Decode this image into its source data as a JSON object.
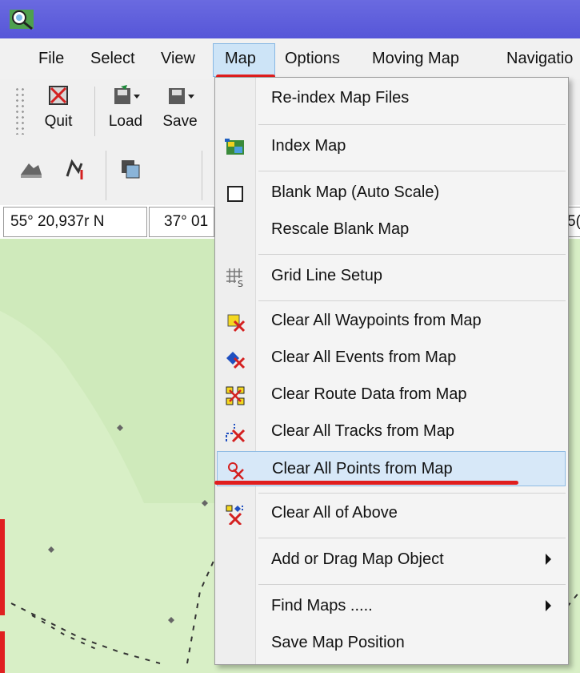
{
  "menubar": {
    "items": [
      "File",
      "Select",
      "View",
      "Map",
      "Options",
      "Moving Map",
      "Navigatio"
    ]
  },
  "toolbar": {
    "buttons": [
      {
        "label": "Quit",
        "icon": "quit-icon"
      },
      {
        "label": "Load",
        "icon": "load-icon"
      },
      {
        "label": "Save",
        "icon": "save-icon"
      }
    ]
  },
  "coords": {
    "lat": "55° 20,937r N",
    "lon": "37° 01",
    "right_fragment": "5("
  },
  "map_menu": {
    "items": [
      {
        "label": "Re-index Map Files",
        "icon": ""
      },
      {
        "label": "Index Map",
        "icon": "index-map-icon"
      },
      {
        "label": "Blank Map (Auto Scale)",
        "icon": "blank-map-icon"
      },
      {
        "label": "Rescale Blank Map",
        "icon": ""
      },
      {
        "label": "Grid Line Setup",
        "icon": "grid-line-icon"
      },
      {
        "label": "Clear All Waypoints from Map",
        "icon": "clear-waypoints-icon"
      },
      {
        "label": "Clear All Events from Map",
        "icon": "clear-events-icon"
      },
      {
        "label": "Clear Route Data from Map",
        "icon": "clear-route-icon"
      },
      {
        "label": "Clear All Tracks from Map",
        "icon": "clear-tracks-icon"
      },
      {
        "label": "Clear All Points from Map",
        "icon": "clear-points-icon",
        "highlighted": true
      },
      {
        "label": "Clear All of Above",
        "icon": "clear-all-icon"
      },
      {
        "label": "Add or Drag Map Object",
        "icon": "",
        "submenu": true
      },
      {
        "label": "Find Maps .....",
        "icon": "",
        "submenu": true
      },
      {
        "label": "Save Map Position",
        "icon": ""
      }
    ]
  },
  "colors": {
    "titlebar": "#5c5cdc",
    "highlight": "#d7e8f8",
    "map_background": "#d8efc6",
    "annotation_red": "#e01e1e"
  }
}
